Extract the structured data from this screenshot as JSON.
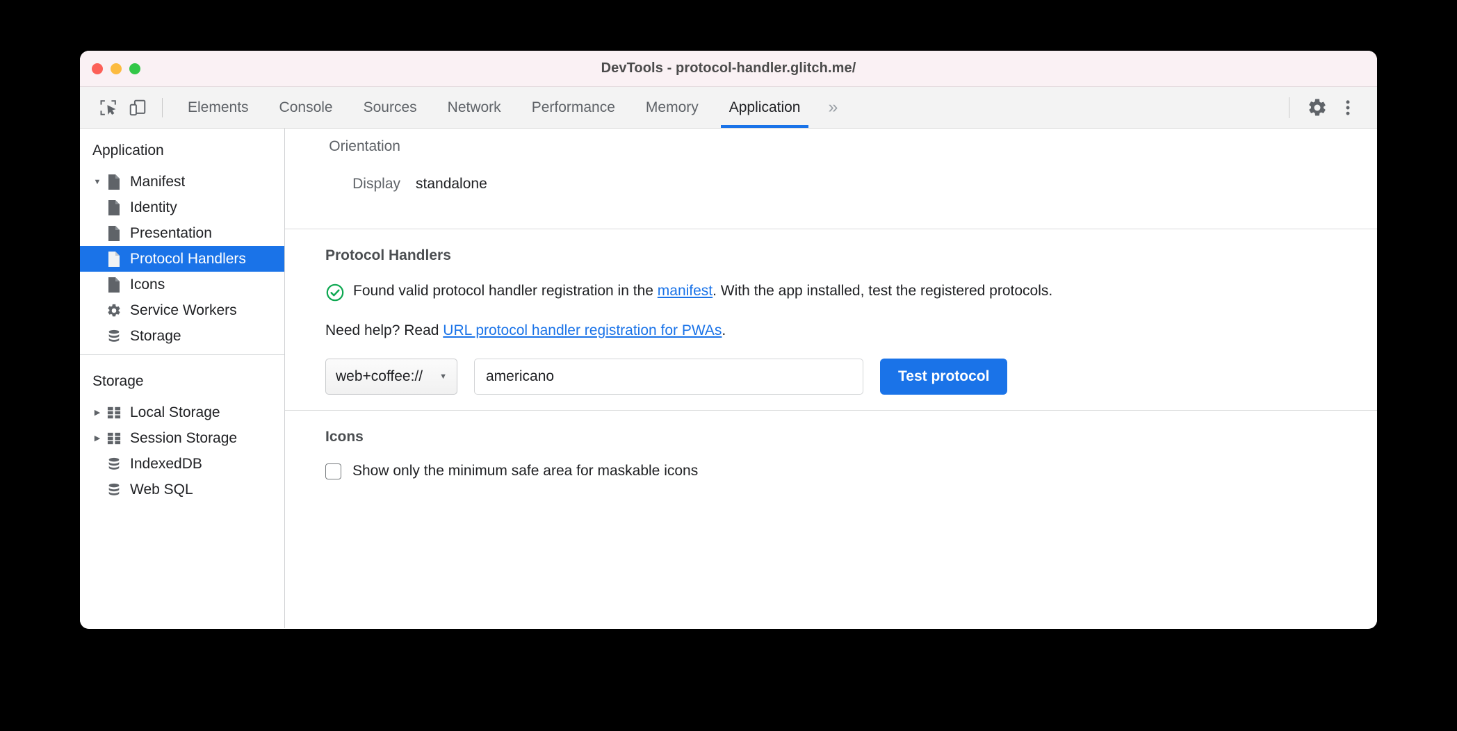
{
  "window": {
    "title": "DevTools - protocol-handler.glitch.me/",
    "traffic_lights": [
      "close-red",
      "minimize-yellow",
      "maximize-green"
    ]
  },
  "toolbar": {
    "inspect_icon": "inspect-element-icon",
    "device_icon": "device-toolbar-icon",
    "more_tabs_label": "»",
    "settings_icon": "gear-icon",
    "menu_icon": "kebab-menu-icon",
    "tabs": [
      {
        "label": "Elements",
        "active": false
      },
      {
        "label": "Console",
        "active": false
      },
      {
        "label": "Sources",
        "active": false
      },
      {
        "label": "Network",
        "active": false
      },
      {
        "label": "Performance",
        "active": false
      },
      {
        "label": "Memory",
        "active": false
      },
      {
        "label": "Application",
        "active": true
      }
    ]
  },
  "sidebar": {
    "application_heading": "Application",
    "application_items": [
      {
        "label": "Manifest",
        "icon": "document-icon",
        "twisty": "expanded",
        "indent": 0,
        "selected": false
      },
      {
        "label": "Identity",
        "icon": "document-icon",
        "twisty": "none",
        "indent": 1,
        "selected": false
      },
      {
        "label": "Presentation",
        "icon": "document-icon",
        "twisty": "none",
        "indent": 1,
        "selected": false
      },
      {
        "label": "Protocol Handlers",
        "icon": "document-icon",
        "twisty": "none",
        "indent": 1,
        "selected": true
      },
      {
        "label": "Icons",
        "icon": "document-icon",
        "twisty": "none",
        "indent": 1,
        "selected": false
      },
      {
        "label": "Service Workers",
        "icon": "gear-icon",
        "twisty": "none",
        "indent": 0,
        "selected": false
      },
      {
        "label": "Storage",
        "icon": "database-icon",
        "twisty": "none",
        "indent": 0,
        "selected": false
      }
    ],
    "storage_heading": "Storage",
    "storage_items": [
      {
        "label": "Local Storage",
        "icon": "table-icon",
        "twisty": "collapsed",
        "indent": 0,
        "selected": false
      },
      {
        "label": "Session Storage",
        "icon": "table-icon",
        "twisty": "collapsed",
        "indent": 0,
        "selected": false
      },
      {
        "label": "IndexedDB",
        "icon": "database-icon",
        "twisty": "none",
        "indent": 0,
        "selected": false
      },
      {
        "label": "Web SQL",
        "icon": "database-icon",
        "twisty": "none",
        "indent": 0,
        "selected": false
      }
    ]
  },
  "manifest": {
    "rows": [
      {
        "label": "Orientation",
        "value": ""
      },
      {
        "label": "Display",
        "value": "standalone"
      }
    ]
  },
  "protocol_handlers": {
    "title": "Protocol Handlers",
    "status_icon": "check-circle-icon",
    "status_text_before": "Found valid protocol handler registration in the ",
    "status_link": "manifest",
    "status_text_after": ". With the app installed, test the registered protocols.",
    "help_text_before": "Need help? Read ",
    "help_link": "URL protocol handler registration for PWAs",
    "help_text_after": ".",
    "scheme_value": "web+coffee://",
    "scheme_caret_icon": "chevron-down-icon",
    "path_value": "americano",
    "path_placeholder": "",
    "test_button_label": "Test protocol"
  },
  "icons_section": {
    "title": "Icons",
    "checkbox_label": "Show only the minimum safe area for maskable icons",
    "checkbox_checked": false
  },
  "colors": {
    "accent": "#1a73e8",
    "success": "#0ca750",
    "titlebar": "#faf1f4",
    "tabbar": "#f3f3f3"
  }
}
